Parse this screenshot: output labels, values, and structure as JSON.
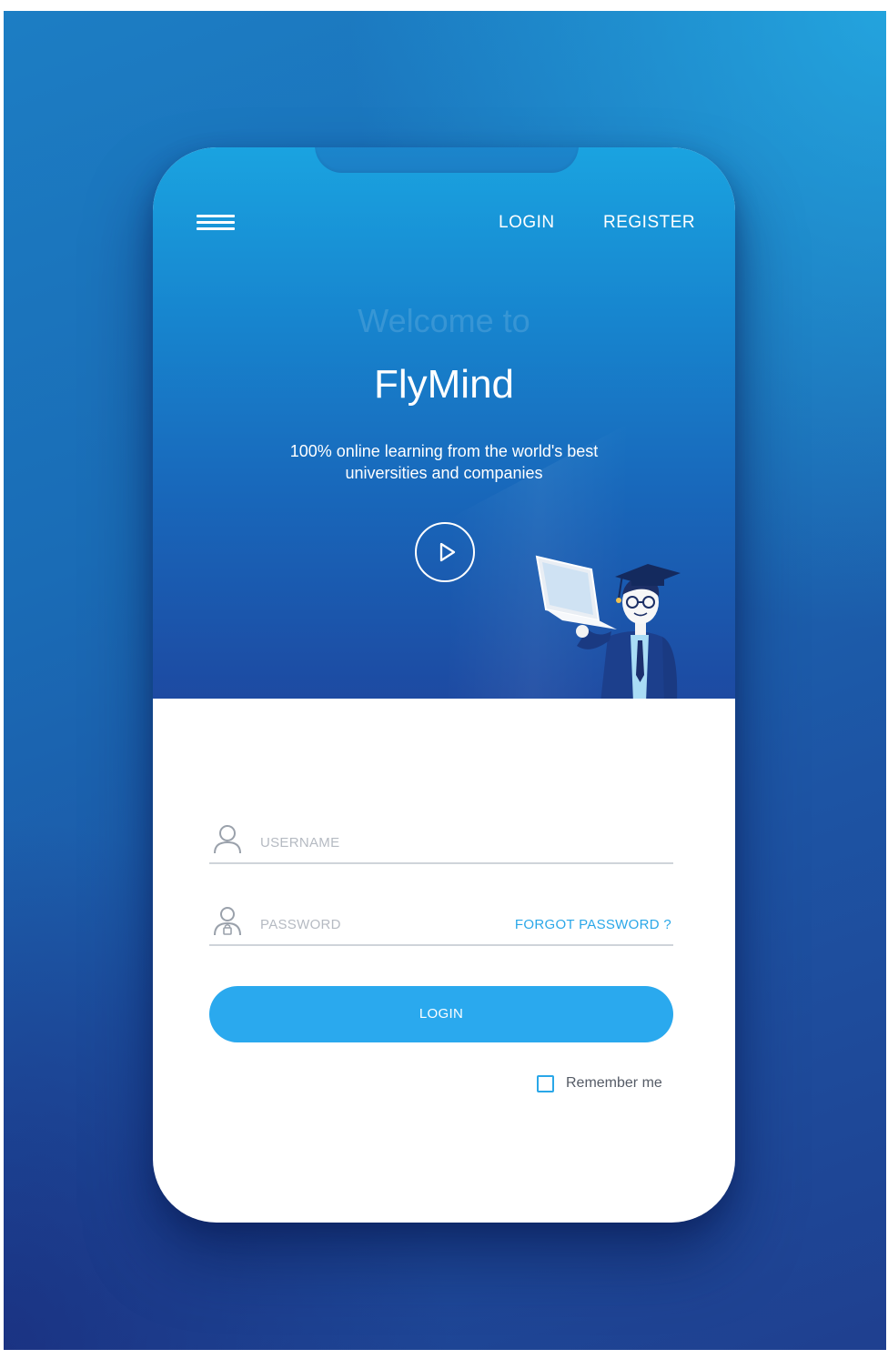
{
  "nav": {
    "login_label": "LOGIN",
    "register_label": "REGISTER"
  },
  "hero": {
    "welcome": "Welcome to",
    "brand": "FlyMind",
    "tagline_line1": "100% online learning from the world's best",
    "tagline_line2": "universities and companies"
  },
  "form": {
    "username_placeholder": "USERNAME",
    "password_placeholder": "PASSWORD",
    "forgot_label": "FORGOT PASSWORD ?",
    "login_button_label": "LOGIN",
    "remember_label": "Remember me",
    "remember_checked": false
  },
  "colors": {
    "accent": "#2aa9ee",
    "hero_top": "#1aa3e0",
    "hero_bottom": "#1d4aa2",
    "background": "#1a6cb6"
  },
  "icons": {
    "menu": "hamburger-menu-icon",
    "play": "play-icon",
    "username": "user-icon",
    "password": "user-lock-icon"
  }
}
